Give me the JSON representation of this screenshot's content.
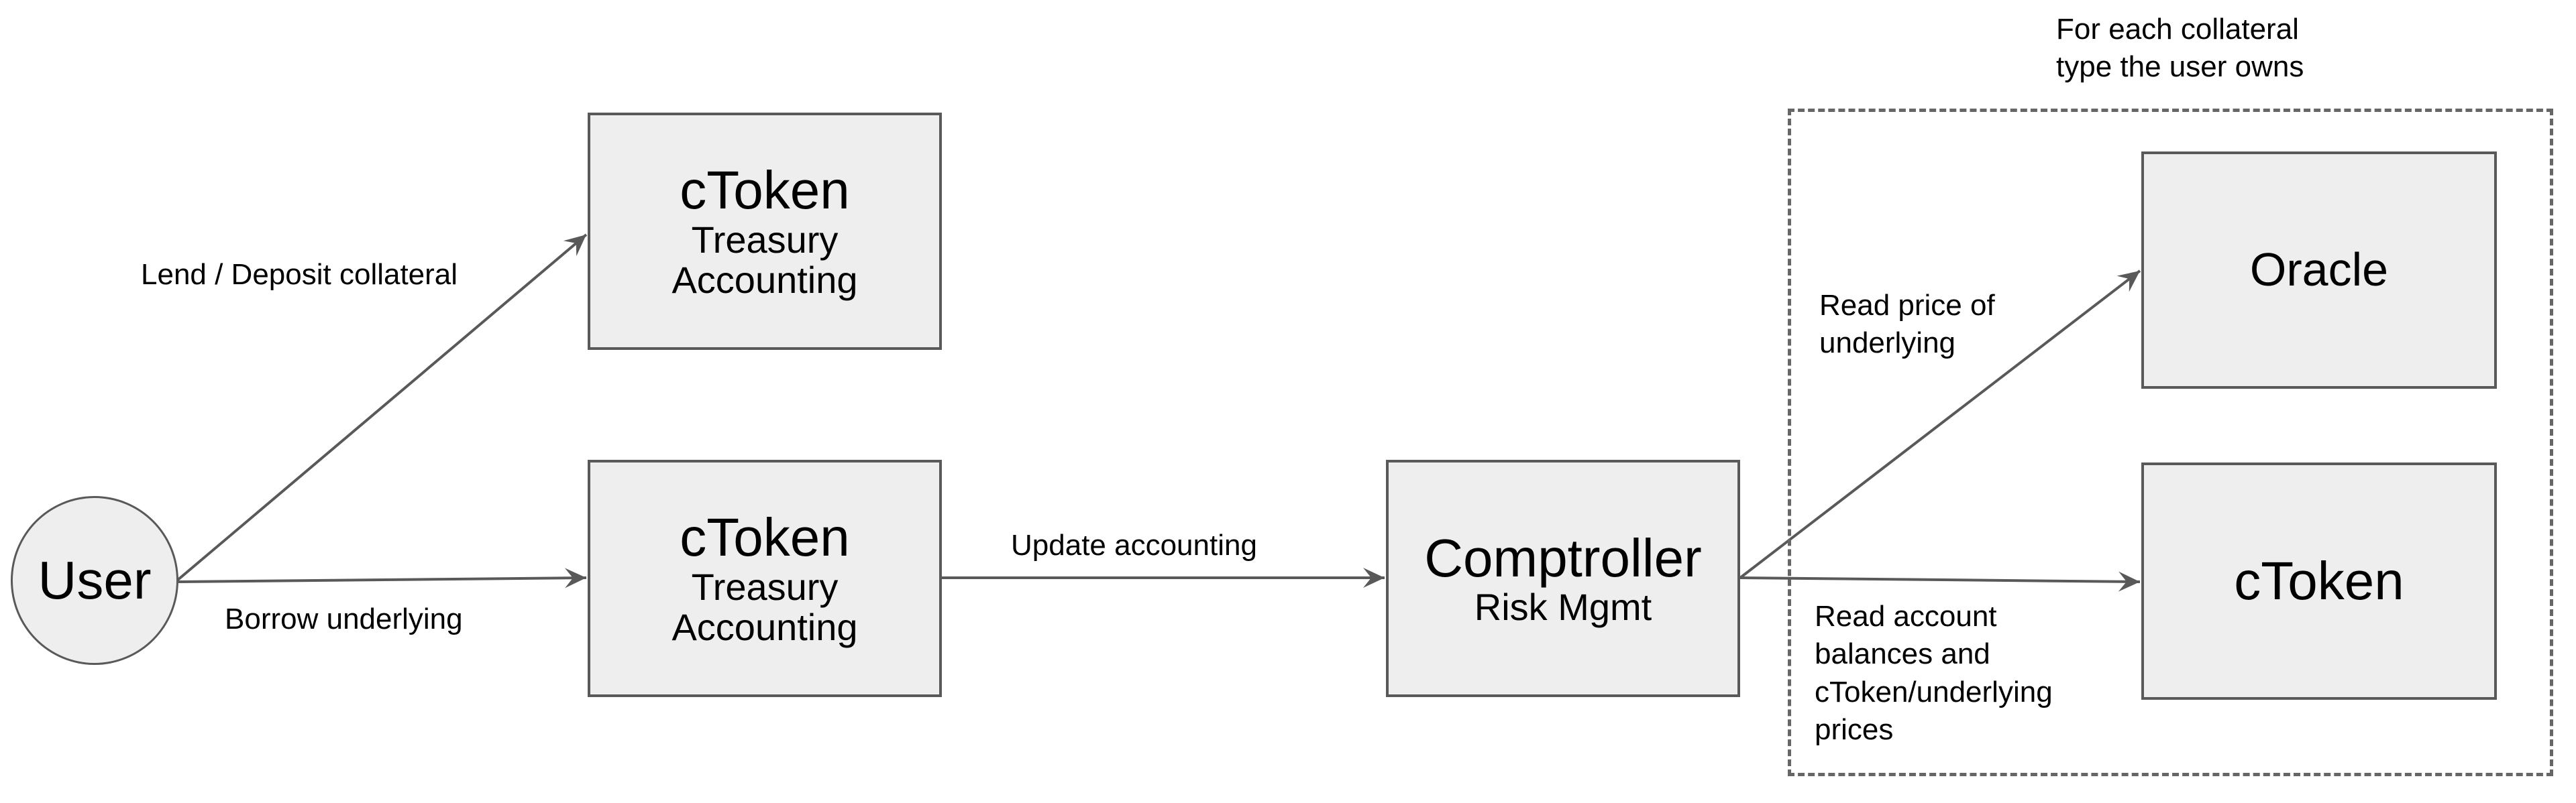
{
  "diagram": {
    "type": "flowchart",
    "nodes": {
      "user": {
        "label": "User"
      },
      "ctoken_top": {
        "title": "cToken",
        "lines": [
          "Treasury",
          "Accounting"
        ]
      },
      "ctoken_mid": {
        "title": "cToken",
        "lines": [
          "Treasury",
          "Accounting"
        ]
      },
      "comptroller": {
        "title": "Comptroller",
        "subtitle": "Risk Mgmt"
      },
      "oracle": {
        "title": "Oracle"
      },
      "ctoken_right": {
        "title": "cToken"
      }
    },
    "group": {
      "label_lines": [
        "For each collateral",
        "type the user owns"
      ],
      "members": [
        "oracle",
        "ctoken_right"
      ]
    },
    "edges": [
      {
        "from": "user",
        "to": "ctoken_top",
        "label_lines": [
          "Lend / Deposit collateral"
        ]
      },
      {
        "from": "user",
        "to": "ctoken_mid",
        "label_lines": [
          "Borrow underlying"
        ]
      },
      {
        "from": "ctoken_mid",
        "to": "comptroller",
        "label_lines": [
          "Update accounting"
        ]
      },
      {
        "from": "comptroller",
        "to": "oracle",
        "label_lines": [
          "Read price of",
          "underlying"
        ]
      },
      {
        "from": "comptroller",
        "to": "ctoken_right",
        "label_lines": [
          "Read account",
          "balances and",
          "cToken/underlying",
          "prices"
        ]
      }
    ],
    "colors": {
      "node_fill": "#eeeeee",
      "node_stroke": "#595959",
      "edge_stroke": "#595959",
      "group_stroke": "#666666",
      "text": "#000000",
      "background": "#ffffff"
    }
  }
}
